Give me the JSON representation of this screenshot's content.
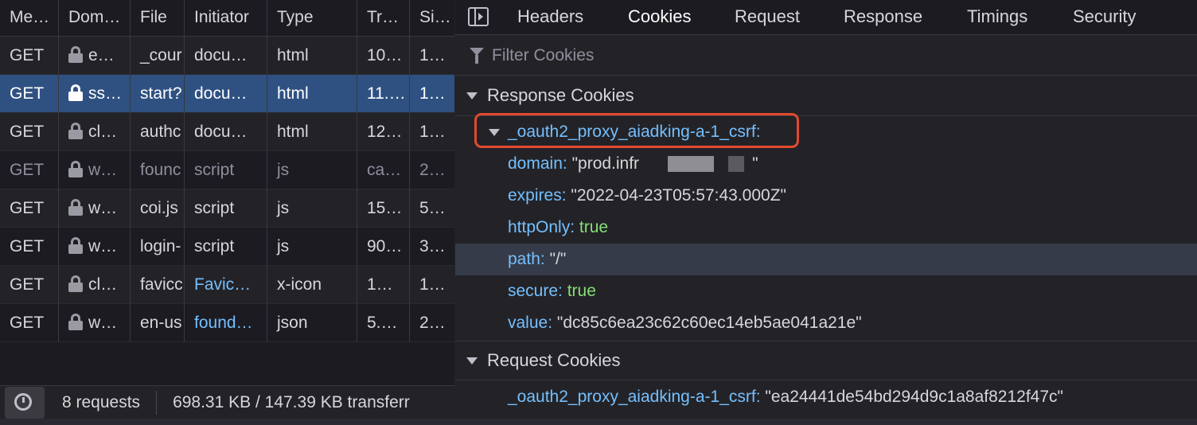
{
  "request_list": {
    "columns": [
      "Me…",
      "Dom…",
      "File",
      "Initiator",
      "Type",
      "Tr…",
      "Si…"
    ],
    "rows": [
      {
        "method": "GET",
        "domain": "e…",
        "file": "_cour",
        "initiator": "docu…",
        "type": "html",
        "transferred": "10…",
        "size": "1…"
      },
      {
        "method": "GET",
        "domain": "ss…",
        "file": "start?",
        "initiator": "docu…",
        "type": "html",
        "transferred": "11.…",
        "size": "1…"
      },
      {
        "method": "GET",
        "domain": "cl…",
        "file": "authc",
        "initiator": "docu…",
        "type": "html",
        "transferred": "12…",
        "size": "1…"
      },
      {
        "method": "GET",
        "domain": "w…",
        "file": "founc",
        "initiator": "script",
        "type": "js",
        "transferred": "ca…",
        "size": "2…"
      },
      {
        "method": "GET",
        "domain": "w…",
        "file": "coi.js",
        "initiator": "script",
        "type": "js",
        "transferred": "15…",
        "size": "5…"
      },
      {
        "method": "GET",
        "domain": "w…",
        "file": "login-",
        "initiator": "script",
        "type": "js",
        "transferred": "90…",
        "size": "3…"
      },
      {
        "method": "GET",
        "domain": "cl…",
        "file": "favicc",
        "initiator": "Favic…",
        "type": "x-icon",
        "transferred": "1…",
        "size": "1…"
      },
      {
        "method": "GET",
        "domain": "w…",
        "file": "en-us",
        "initiator": "found…",
        "type": "json",
        "transferred": "5.…",
        "size": "2…"
      }
    ],
    "selected_index": 1
  },
  "status_bar": {
    "requests": "8 requests",
    "transfer": "698.31 KB / 147.39 KB transferr"
  },
  "detail_tabs": [
    "Headers",
    "Cookies",
    "Request",
    "Response",
    "Timings",
    "Security"
  ],
  "active_tab": "Cookies",
  "filter": {
    "placeholder": "Filter Cookies",
    "value": ""
  },
  "response_cookies": {
    "title": "Response Cookies",
    "cookie_name": "_oauth2_proxy_aiadking-a-1_csrf:",
    "fields": {
      "domain_key": "domain:",
      "domain_value": "\"prod.infr",
      "domain_end": "\"",
      "expires_key": "expires:",
      "expires_value": "\"2022-04-23T05:57:43.000Z\"",
      "httponly_key": "httpOnly:",
      "httponly_value": "true",
      "path_key": "path:",
      "path_value": "\"/\"",
      "secure_key": "secure:",
      "secure_value": "true",
      "value_key": "value:",
      "value_value": "\"dc85c6ea23c62c60ec14eb5ae041a21e\""
    }
  },
  "request_cookies": {
    "title": "Request Cookies",
    "name": "_oauth2_proxy_aiadking-a-1_csrf:",
    "value": "\"ea24441de54bd294d9c1a8af8212f47c\""
  },
  "colors": {
    "selection": "#2f5182",
    "key": "#75bfff",
    "boolean": "#86de74",
    "highlight_box": "#e24a2d"
  }
}
